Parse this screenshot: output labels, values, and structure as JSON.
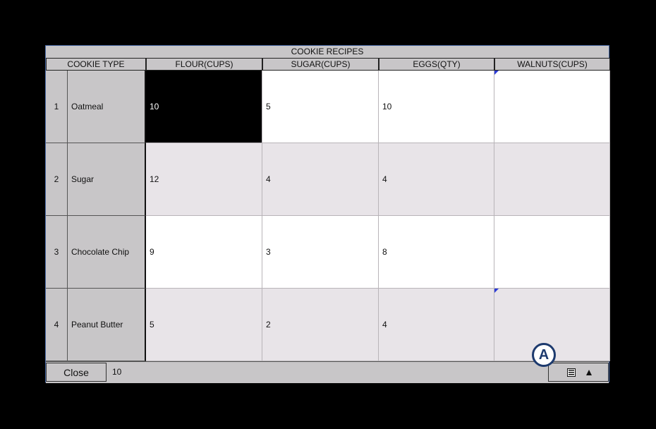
{
  "window": {
    "title": "COOKIE RECIPES"
  },
  "columns": [
    "COOKIE TYPE",
    "FLOUR(CUPS)",
    "SUGAR(CUPS)",
    "EGGS(QTY)",
    "WALNUTS(CUPS)"
  ],
  "rows": [
    {
      "num": "1",
      "type": "Oatmeal",
      "flour": "10",
      "sugar": "5",
      "eggs": "10",
      "walnuts": ""
    },
    {
      "num": "2",
      "type": "Sugar",
      "flour": "12",
      "sugar": "4",
      "eggs": "4",
      "walnuts": ""
    },
    {
      "num": "3",
      "type": "Chocolate Chip",
      "flour": "9",
      "sugar": "3",
      "eggs": "8",
      "walnuts": ""
    },
    {
      "num": "4",
      "type": "Peanut Butter",
      "flour": "5",
      "sugar": "2",
      "eggs": "4",
      "walnuts": ""
    }
  ],
  "bottom": {
    "close_label": "Close",
    "value_display": "10",
    "keyboard_icon": "keyboard-icon",
    "up_icon": "triangle-up-icon"
  },
  "callout": {
    "label": "A"
  },
  "colors": {
    "selected_cell": "#000000",
    "marker": "#2a3ad8",
    "callout": "#1d3a6e"
  }
}
